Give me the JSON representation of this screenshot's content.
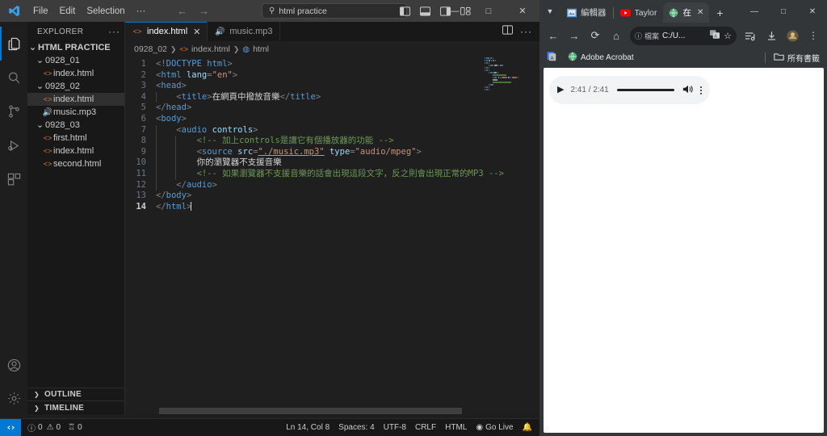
{
  "vscode": {
    "menu": [
      "File",
      "Edit",
      "Selection",
      "···"
    ],
    "nav": {
      "back": "←",
      "forward": "→"
    },
    "search": {
      "value": "html practice",
      "placeholder": "Search"
    },
    "layout_icons": [
      "toggle-primary-sidebar",
      "toggle-panel",
      "toggle-secondary-sidebar",
      "customize-layout"
    ],
    "window_controls": {
      "minimize": "—",
      "maximize": "□",
      "close": "✕"
    },
    "activitybar": [
      {
        "name": "explorer",
        "active": true
      },
      {
        "name": "search",
        "active": false
      },
      {
        "name": "source-control",
        "active": false
      },
      {
        "name": "run-and-debug",
        "active": false
      },
      {
        "name": "extensions",
        "active": false
      },
      {
        "name": "accounts",
        "active": false
      },
      {
        "name": "manage-settings",
        "active": false
      }
    ],
    "sidebar": {
      "title": "EXPLORER",
      "more": "···",
      "tree": [
        {
          "label": "HTML PRACTICE",
          "depth": 0,
          "type": "root",
          "expanded": true,
          "selected": false
        },
        {
          "label": "0928_01",
          "depth": 1,
          "type": "folder",
          "expanded": true,
          "selected": false
        },
        {
          "label": "index.html",
          "depth": 2,
          "type": "html",
          "selected": false
        },
        {
          "label": "0928_02",
          "depth": 1,
          "type": "folder",
          "expanded": true,
          "selected": false
        },
        {
          "label": "index.html",
          "depth": 2,
          "type": "html",
          "selected": true
        },
        {
          "label": "music.mp3",
          "depth": 2,
          "type": "audio",
          "selected": false
        },
        {
          "label": "0928_03",
          "depth": 1,
          "type": "folder",
          "expanded": true,
          "selected": false
        },
        {
          "label": "first.html",
          "depth": 2,
          "type": "html",
          "selected": false
        },
        {
          "label": "index.html",
          "depth": 2,
          "type": "html",
          "selected": false
        },
        {
          "label": "second.html",
          "depth": 2,
          "type": "html",
          "selected": false
        }
      ],
      "sections": [
        "OUTLINE",
        "TIMELINE"
      ]
    },
    "tabs": [
      {
        "label": "index.html",
        "icon": "html",
        "active": true,
        "close": "✕"
      },
      {
        "label": "music.mp3",
        "icon": "audio",
        "active": false
      }
    ],
    "editor_actions": [
      "split-editor",
      "more-actions"
    ],
    "breadcrumb": [
      "0928_02",
      "index.html",
      "html"
    ],
    "code_lines": [
      {
        "n": "1",
        "indent": 0,
        "cur": false,
        "tokens": [
          {
            "t": "punc",
            "v": "<!"
          },
          {
            "t": "dt",
            "v": "DOCTYPE"
          },
          {
            "t": "txt",
            "v": " "
          },
          {
            "t": "tag",
            "v": "html"
          },
          {
            "t": "punc",
            "v": ">"
          }
        ]
      },
      {
        "n": "2",
        "indent": 0,
        "cur": false,
        "tokens": [
          {
            "t": "punc",
            "v": "<"
          },
          {
            "t": "tag",
            "v": "html"
          },
          {
            "t": "txt",
            "v": " "
          },
          {
            "t": "attr",
            "v": "lang"
          },
          {
            "t": "punc",
            "v": "="
          },
          {
            "t": "str",
            "v": "\"en\""
          },
          {
            "t": "punc",
            "v": ">"
          }
        ]
      },
      {
        "n": "3",
        "indent": 0,
        "cur": false,
        "tokens": [
          {
            "t": "punc",
            "v": "<"
          },
          {
            "t": "tag",
            "v": "head"
          },
          {
            "t": "punc",
            "v": ">"
          }
        ]
      },
      {
        "n": "4",
        "indent": 1,
        "cur": false,
        "tokens": [
          {
            "t": "txt",
            "v": "    "
          },
          {
            "t": "punc",
            "v": "<"
          },
          {
            "t": "tag",
            "v": "title"
          },
          {
            "t": "punc",
            "v": ">"
          },
          {
            "t": "txt",
            "v": "在網頁中撥放音樂"
          },
          {
            "t": "punc",
            "v": "</"
          },
          {
            "t": "tag",
            "v": "title"
          },
          {
            "t": "punc",
            "v": ">"
          }
        ]
      },
      {
        "n": "5",
        "indent": 0,
        "cur": false,
        "tokens": [
          {
            "t": "punc",
            "v": "</"
          },
          {
            "t": "tag",
            "v": "head"
          },
          {
            "t": "punc",
            "v": ">"
          }
        ]
      },
      {
        "n": "6",
        "indent": 0,
        "cur": false,
        "tokens": [
          {
            "t": "punc",
            "v": "<"
          },
          {
            "t": "tag",
            "v": "body"
          },
          {
            "t": "punc",
            "v": ">"
          }
        ]
      },
      {
        "n": "7",
        "indent": 1,
        "cur": false,
        "tokens": [
          {
            "t": "txt",
            "v": "    "
          },
          {
            "t": "punc",
            "v": "<"
          },
          {
            "t": "tag",
            "v": "audio"
          },
          {
            "t": "txt",
            "v": " "
          },
          {
            "t": "attr",
            "v": "controls"
          },
          {
            "t": "punc",
            "v": ">"
          }
        ]
      },
      {
        "n": "8",
        "indent": 2,
        "cur": false,
        "tokens": [
          {
            "t": "txt",
            "v": "        "
          },
          {
            "t": "com",
            "v": "<!-- 加上controls是讓它有個播放器的功能 -->"
          }
        ]
      },
      {
        "n": "9",
        "indent": 2,
        "cur": false,
        "tokens": [
          {
            "t": "txt",
            "v": "        "
          },
          {
            "t": "punc",
            "v": "<"
          },
          {
            "t": "tag",
            "v": "source"
          },
          {
            "t": "txt",
            "v": " "
          },
          {
            "t": "attr",
            "v": "src"
          },
          {
            "t": "punc",
            "v": "="
          },
          {
            "t": "strlink",
            "v": "\"./music.mp3\""
          },
          {
            "t": "txt",
            "v": " "
          },
          {
            "t": "attr",
            "v": "type"
          },
          {
            "t": "punc",
            "v": "="
          },
          {
            "t": "str",
            "v": "\"audio/mpeg\""
          },
          {
            "t": "punc",
            "v": ">"
          }
        ]
      },
      {
        "n": "10",
        "indent": 2,
        "cur": false,
        "tokens": [
          {
            "t": "txt",
            "v": "        "
          },
          {
            "t": "txt",
            "v": "你的瀏覽器不支援音樂"
          }
        ]
      },
      {
        "n": "11",
        "indent": 2,
        "cur": false,
        "tokens": [
          {
            "t": "txt",
            "v": "        "
          },
          {
            "t": "com",
            "v": "<!-- 如果瀏覽器不支援音樂的話會出現這段文字，反之則會出現正常的MP3 -->"
          }
        ]
      },
      {
        "n": "12",
        "indent": 1,
        "cur": false,
        "tokens": [
          {
            "t": "txt",
            "v": "    "
          },
          {
            "t": "punc",
            "v": "</"
          },
          {
            "t": "tag",
            "v": "audio"
          },
          {
            "t": "punc",
            "v": ">"
          }
        ]
      },
      {
        "n": "13",
        "indent": 0,
        "cur": false,
        "tokens": [
          {
            "t": "punc",
            "v": "</"
          },
          {
            "t": "tag",
            "v": "body"
          },
          {
            "t": "punc",
            "v": ">"
          }
        ]
      },
      {
        "n": "14",
        "indent": 0,
        "cur": true,
        "tokens": [
          {
            "t": "punc",
            "v": "</"
          },
          {
            "t": "tag",
            "v": "html"
          },
          {
            "t": "punc",
            "v": ">"
          },
          {
            "t": "caret",
            "v": ""
          }
        ]
      }
    ],
    "statusbar": {
      "remote": "remote-window-icon",
      "errors": "0",
      "warnings": "0",
      "ports": "0",
      "position": "Ln 14, Col 8",
      "spaces": "Spaces: 4",
      "encoding": "UTF-8",
      "eol": "CRLF",
      "language": "HTML",
      "golive": "Go Live",
      "notifications": "bell-icon"
    }
  },
  "browser": {
    "tabs": [
      {
        "label": "編輯器",
        "favicon": "image-icon",
        "active": false
      },
      {
        "label": "Taylor",
        "favicon": "youtube-icon",
        "active": false
      },
      {
        "label": "在",
        "favicon": "globe-icon",
        "active": true,
        "close": "✕"
      }
    ],
    "new_tab": "+",
    "window_controls": {
      "minimize": "—",
      "maximize": "□",
      "close": "✕"
    },
    "toolbar": {
      "back": "←",
      "forward": "→",
      "reload": "⟳",
      "home": "⌂",
      "omnibox_chip": "檔案",
      "omnibox_url": "C:/U...",
      "translate": "translate-icon",
      "bookmark_star": "☆",
      "reading_list": "reading-list-icon",
      "downloads": "download-icon",
      "profile": "profile-avatar",
      "menu": "⋮"
    },
    "bookmarks": {
      "items": [
        {
          "label": "",
          "icon": "google-docs-icon"
        },
        {
          "label": "Adobe Acrobat",
          "icon": "globe-icon"
        }
      ],
      "all_bookmarks": "所有書籤"
    },
    "audio_player": {
      "play": "▶",
      "time": "2:41 / 2:41",
      "volume": "volume-icon",
      "menu": "more-options-icon"
    }
  }
}
